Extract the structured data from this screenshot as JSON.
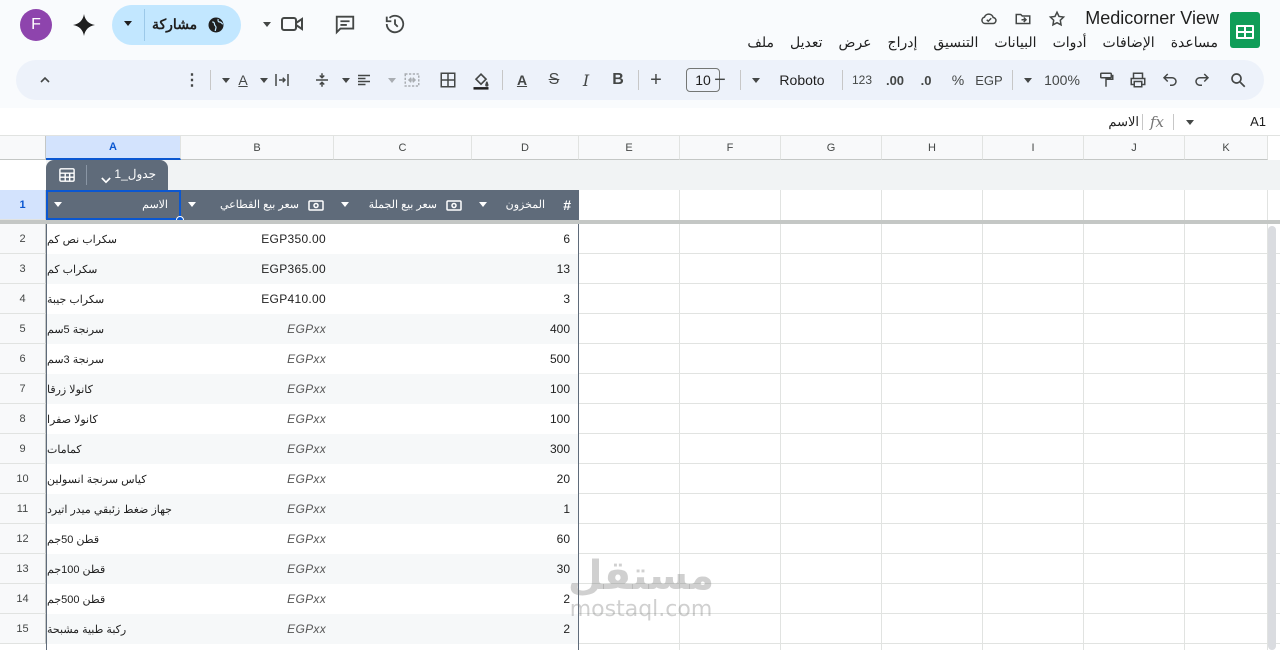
{
  "app": {
    "doc_title": "Medicorner View",
    "avatar_letter": "F",
    "share_label": "مشاركة",
    "accent_color": "#c2e7ff",
    "brand_color": "#0f9d58"
  },
  "menu": [
    "ملف",
    "تعديل",
    "عرض",
    "إدراج",
    "التنسيق",
    "البيانات",
    "أدوات",
    "الإضافات",
    "مساعدة"
  ],
  "toolbar": {
    "zoom": "100%",
    "currency": "EGP",
    "percent": "%",
    "decimal_decrease": ".0",
    "decimal_increase": ".00",
    "number_format": "123",
    "font": "Roboto",
    "font_size": "10",
    "bold": "B",
    "italic": "I",
    "strike": "S",
    "text_color": "A",
    "minus": "−",
    "plus": "+"
  },
  "formula_bar": {
    "name_box": "A1",
    "fx": "fx",
    "value": "الاسم"
  },
  "columns": [
    "A",
    "B",
    "C",
    "D",
    "E",
    "F",
    "G",
    "H",
    "I",
    "J",
    "K"
  ],
  "table": {
    "tab_label": "جدول_1",
    "headers": {
      "name": "الاسم",
      "retail": "سعر بيع القطاعي",
      "wholesale": "سعر بيع الجملة",
      "stock": "المخزون"
    },
    "rows": [
      {
        "n": "2",
        "name": "سكراب نص كم",
        "retail": "EGP350.00",
        "stock": "6",
        "placeholder": false
      },
      {
        "n": "3",
        "name": "سكراب كم",
        "retail": "EGP365.00",
        "stock": "13",
        "placeholder": false
      },
      {
        "n": "4",
        "name": "سكراب جيبة",
        "retail": "EGP410.00",
        "stock": "3",
        "placeholder": false
      },
      {
        "n": "5",
        "name": "سرنجة 5سم",
        "retail": "EGPxx",
        "stock": "400",
        "placeholder": true
      },
      {
        "n": "6",
        "name": "سرنجة 3سم",
        "retail": "EGPxx",
        "stock": "500",
        "placeholder": true
      },
      {
        "n": "7",
        "name": "كانولا زرقا",
        "retail": "EGPxx",
        "stock": "100",
        "placeholder": true
      },
      {
        "n": "8",
        "name": "كانولا صفرا",
        "retail": "EGPxx",
        "stock": "100",
        "placeholder": true
      },
      {
        "n": "9",
        "name": "كمامات",
        "retail": "EGPxx",
        "stock": "300",
        "placeholder": true
      },
      {
        "n": "10",
        "name": "كياس سرنجة انسولين",
        "retail": "EGPxx",
        "stock": "20",
        "placeholder": true
      },
      {
        "n": "11",
        "name": "جهاز ضغط زئبقي ميدر اتيرد",
        "retail": "EGPxx",
        "stock": "1",
        "placeholder": true
      },
      {
        "n": "12",
        "name": "قطن 50جم",
        "retail": "EGPxx",
        "stock": "60",
        "placeholder": true
      },
      {
        "n": "13",
        "name": "قطن 100جم",
        "retail": "EGPxx",
        "stock": "30",
        "placeholder": true
      },
      {
        "n": "14",
        "name": "قطن 500جم",
        "retail": "EGPxx",
        "stock": "2",
        "placeholder": true
      },
      {
        "n": "15",
        "name": "ركبة طبية مشبحة",
        "retail": "EGPxx",
        "stock": "2",
        "placeholder": true
      }
    ]
  },
  "watermark": {
    "main": "مستقل",
    "sub": "mostaql.com"
  }
}
